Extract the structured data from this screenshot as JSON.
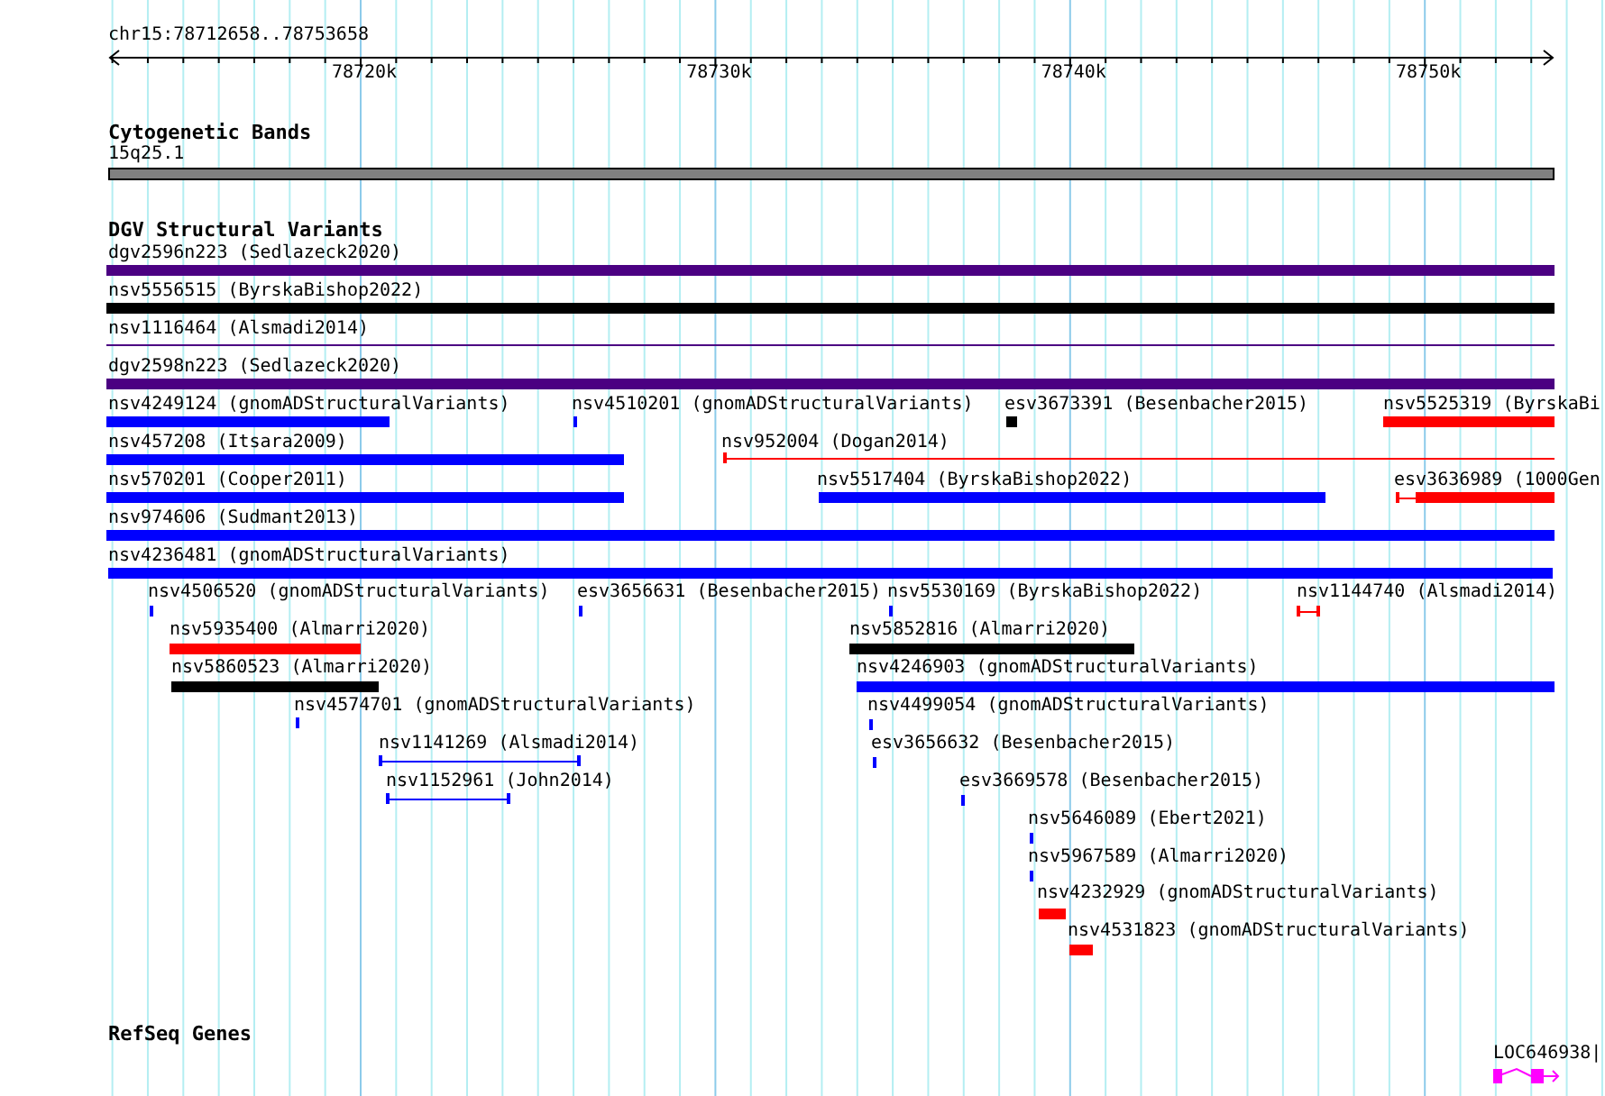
{
  "ruler": {
    "location": "chr15:78712658..78753658",
    "ticks": [
      "78720k",
      "78730k",
      "78740k",
      "78750k"
    ]
  },
  "cytogenetic_bands": {
    "title": "Cytogenetic Bands",
    "band": "15q25.1"
  },
  "dgv_structural_variants": {
    "title": "DGV Structural Variants",
    "features": [
      {
        "label": "dgv2596n223 (Sedlazeck2020)",
        "color": "#4b0082",
        "kind": "bar"
      },
      {
        "label": "nsv5556515 (ByrskaBishop2022)",
        "color": "#000000",
        "kind": "bar"
      },
      {
        "label": "nsv1116464 (Alsmadi2014)",
        "color": "#4b0082",
        "kind": "line"
      },
      {
        "label": "dgv2598n223 (Sedlazeck2020)",
        "color": "#4b0082",
        "kind": "bar"
      },
      {
        "label": "nsv4249124 (gnomADStructuralVariants)",
        "color": "#0000ff",
        "kind": "bar"
      },
      {
        "label": "nsv4510201 (gnomADStructuralVariants)",
        "color": "#0000ff",
        "kind": "bar"
      },
      {
        "label": "esv3673391 (Besenbacher2015)",
        "color": "#000000",
        "kind": "bar"
      },
      {
        "label": "nsv5525319 (ByrskaBi",
        "color": "#ff0000",
        "kind": "bar"
      },
      {
        "label": "nsv457208 (Itsara2009)",
        "color": "#0000ff",
        "kind": "bar"
      },
      {
        "label": "nsv952004 (Dogan2014)",
        "color": "#ff0000",
        "kind": "interval"
      },
      {
        "label": "nsv570201 (Cooper2011)",
        "color": "#0000ff",
        "kind": "bar"
      },
      {
        "label": "nsv5517404 (ByrskaBishop2022)",
        "color": "#0000ff",
        "kind": "bar"
      },
      {
        "label": "esv3636989 (1000Gen",
        "color": "#ff0000",
        "kind": "capped"
      },
      {
        "label": "nsv974606 (Sudmant2013)",
        "color": "#0000ff",
        "kind": "bar"
      },
      {
        "label": "nsv4236481 (gnomADStructuralVariants)",
        "color": "#0000ff",
        "kind": "bar"
      },
      {
        "label": "nsv4506520 (gnomADStructuralVariants)",
        "color": "#0000ff",
        "kind": "bar"
      },
      {
        "label": "esv3656631 (Besenbacher2015)",
        "color": "#0000ff",
        "kind": "bar"
      },
      {
        "label": "nsv5530169 (ByrskaBishop2022)",
        "color": "#0000ff",
        "kind": "bar"
      },
      {
        "label": "nsv1144740 (Alsmadi2014)",
        "color": "#ff0000",
        "kind": "interval"
      },
      {
        "label": "nsv5935400 (Almarri2020)",
        "color": "#ff0000",
        "kind": "bar"
      },
      {
        "label": "nsv5852816 (Almarri2020)",
        "color": "#000000",
        "kind": "bar"
      },
      {
        "label": "nsv5860523 (Almarri2020)",
        "color": "#000000",
        "kind": "bar"
      },
      {
        "label": "nsv4246903 (gnomADStructuralVariants)",
        "color": "#0000ff",
        "kind": "bar"
      },
      {
        "label": "nsv4574701 (gnomADStructuralVariants)",
        "color": "#0000ff",
        "kind": "bar"
      },
      {
        "label": "nsv4499054 (gnomADStructuralVariants)",
        "color": "#0000ff",
        "kind": "bar"
      },
      {
        "label": "nsv1141269 (Alsmadi2014)",
        "color": "#0000ff",
        "kind": "interval"
      },
      {
        "label": "esv3656632 (Besenbacher2015)",
        "color": "#0000ff",
        "kind": "bar"
      },
      {
        "label": "nsv1152961 (John2014)",
        "color": "#0000ff",
        "kind": "interval"
      },
      {
        "label": "esv3669578 (Besenbacher2015)",
        "color": "#0000ff",
        "kind": "bar"
      },
      {
        "label": "nsv5646089 (Ebert2021)",
        "color": "#0000ff",
        "kind": "bar"
      },
      {
        "label": "nsv5967589 (Almarri2020)",
        "color": "#0000ff",
        "kind": "bar"
      },
      {
        "label": "nsv4232929 (gnomADStructuralVariants)",
        "color": "#ff0000",
        "kind": "bar"
      },
      {
        "label": "nsv4531823 (gnomADStructuralVariants)",
        "color": "#ff0000",
        "kind": "bar"
      }
    ]
  },
  "refseq_genes": {
    "title": "RefSeq Genes",
    "genes": [
      {
        "label": "LOC646938|"
      }
    ]
  }
}
